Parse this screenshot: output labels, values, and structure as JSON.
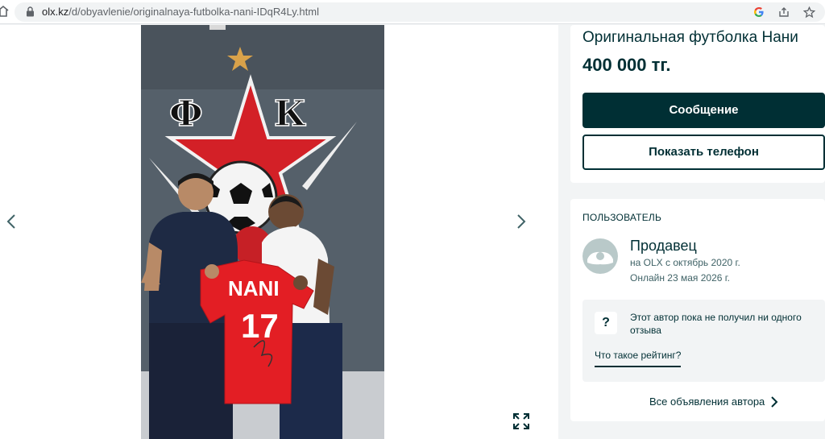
{
  "browser": {
    "url_domain": "olx.kz",
    "url_path": "/d/obyavlenie/originalnaya-futbolka-nani-IDqR4Ly.html",
    "icons": [
      "home-icon",
      "lock-icon",
      "google-icon",
      "share-icon",
      "star-icon"
    ]
  },
  "gallery": {
    "jersey_name": "NANI",
    "jersey_number": "17",
    "club_letters": [
      "Ф",
      "К"
    ],
    "controls": [
      "prev-arrow-icon",
      "next-arrow-icon",
      "fullscreen-icon"
    ]
  },
  "ad": {
    "title": "Оригинальная футболка Нани",
    "price": "400 000 тг.",
    "message_button": "Сообщение",
    "phone_button": "Показать телефон"
  },
  "user": {
    "section_label": "ПОЛЬЗОВАТЕЛЬ",
    "name": "Продавец",
    "since": "на OLX с октябрь 2020 г.",
    "online": "Онлайн 23 мая 2026 г.",
    "rating_icon": "?",
    "rating_text": "Этот автор пока не получил ни одного отзыва",
    "rating_link": "Что такое рейтинг?",
    "all_ads": "Все объявления автора"
  },
  "colors": {
    "brand_dark": "#002f34",
    "page_bg": "#f2f4f5",
    "jersey_red": "#e31e24"
  }
}
